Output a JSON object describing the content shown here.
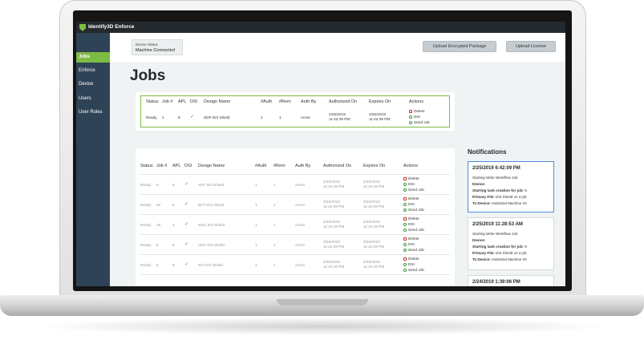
{
  "app": {
    "title": "Identify3D Enforce"
  },
  "sidebar": {
    "items": [
      {
        "label": "Jobs"
      },
      {
        "label": "Enforce"
      },
      {
        "label": "Device"
      },
      {
        "label": "Users"
      },
      {
        "label": "User Roles"
      }
    ]
  },
  "device_status": {
    "label": "Device Status",
    "value": "Machine Connected"
  },
  "toolbar": {
    "upload_package": "Upload Encrypted Package",
    "upload_license": "Upload License"
  },
  "page": {
    "title": "Jobs"
  },
  "colors": {
    "accent": "#7dbb43",
    "sidebar": "#2f4357",
    "appbar": "#23292d",
    "active_notification": "#4a90d9"
  },
  "active_job": {
    "headers": [
      "Status",
      "Job #",
      "APL",
      "DSI",
      "Design Name",
      "#Auth",
      "#Rem",
      "Auth By",
      "Authorized On",
      "Expires On",
      "Actions"
    ],
    "row": {
      "status": "Ready",
      "job": "1",
      "apl": "8",
      "dsi": "✓",
      "design": "SDP ID3 Shield",
      "auth": "1",
      "rem": "1",
      "auth_by": "Acme",
      "authorized_date": "2/25/2019",
      "authorized_time": "11:42:39 PM",
      "expires_date": "2/25/2019",
      "expires_time": "11:42:39 PM"
    },
    "actions": [
      "Delete",
      "DSI",
      "Send Job"
    ]
  },
  "jobs": {
    "headers": [
      "Status",
      "Job #",
      "APL",
      "DSI",
      "Design Name",
      "#Auth",
      "#Rem",
      "Auth By",
      "Authorized On",
      "Expires On",
      "Actions"
    ],
    "rows": [
      {
        "status": "Ready",
        "job": "5",
        "apl": "8",
        "dsi": "✓",
        "design": "XRT ID3 Shield",
        "auth": "1",
        "rem": "1",
        "auth_by": "Acme",
        "authorized_date": "2/25/2019",
        "authorized_time": "11:42:39 PM",
        "expires_date": "2/25/2019",
        "expires_time": "11:42:39 PM"
      },
      {
        "status": "Ready",
        "job": "50",
        "apl": "6",
        "dsi": "✓",
        "design": "BGT ID3 Shield",
        "auth": "1",
        "rem": "1",
        "auth_by": "Acme",
        "authorized_date": "2/25/2019",
        "authorized_time": "11:42:39 PM",
        "expires_date": "2/25/2019",
        "expires_time": "11:42:39 PM"
      },
      {
        "status": "Ready",
        "job": "46",
        "apl": "4",
        "dsi": "✓",
        "design": "NIKL ID3 Shield",
        "auth": "1",
        "rem": "1",
        "auth_by": "Acme",
        "authorized_date": "2/25/2019",
        "authorized_time": "11:42:39 PM",
        "expires_date": "2/25/2019",
        "expires_time": "11:42:39 PM"
      },
      {
        "status": "Ready",
        "job": "5",
        "apl": "8",
        "dsi": "✓",
        "design": "UDX ID3 Shield",
        "auth": "1",
        "rem": "1",
        "auth_by": "Acme",
        "authorized_date": "2/25/2019",
        "authorized_time": "11:42:39 PM",
        "expires_date": "2/25/2019",
        "expires_time": "11:42:39 PM"
      },
      {
        "status": "Ready",
        "job": "5",
        "apl": "8",
        "dsi": "✓",
        "design": "NVI ID3 Shield",
        "auth": "1",
        "rem": "1",
        "auth_by": "Acme",
        "authorized_date": "2/25/2019",
        "authorized_time": "11:42:39 PM",
        "expires_date": "2/25/2019",
        "expires_time": "11:42:39 PM"
      }
    ],
    "actions": [
      "Delete",
      "DSI",
      "Send Job"
    ]
  },
  "notifications": {
    "title": "Notifications",
    "items": [
      {
        "date": "2/25/2019 6:42:09 PM",
        "lines": [
          {
            "label": "",
            "value": "Starting Write Workflow Job"
          },
          {
            "label": "Device:",
            "value": ""
          },
          {
            "label": "Starting task creation for job:",
            "value": "9"
          },
          {
            "label": "Primary File:",
            "value": "ID3 Shield v2 3 job"
          },
          {
            "label": "To Device:",
            "value": "Industrial Machine #2"
          }
        ]
      },
      {
        "date": "2/25/2019 11:28:53 AM",
        "lines": [
          {
            "label": "",
            "value": "Starting Write Workflow Job"
          },
          {
            "label": "Device:",
            "value": ""
          },
          {
            "label": "Starting task creation for job:",
            "value": "9"
          },
          {
            "label": "Primary File:",
            "value": "ID3 Shield v2 3 job"
          },
          {
            "label": "To Device:",
            "value": "Industrial Machine #2"
          }
        ]
      },
      {
        "date": "2/24/2019 1:39:06 PM",
        "lines": []
      }
    ]
  }
}
